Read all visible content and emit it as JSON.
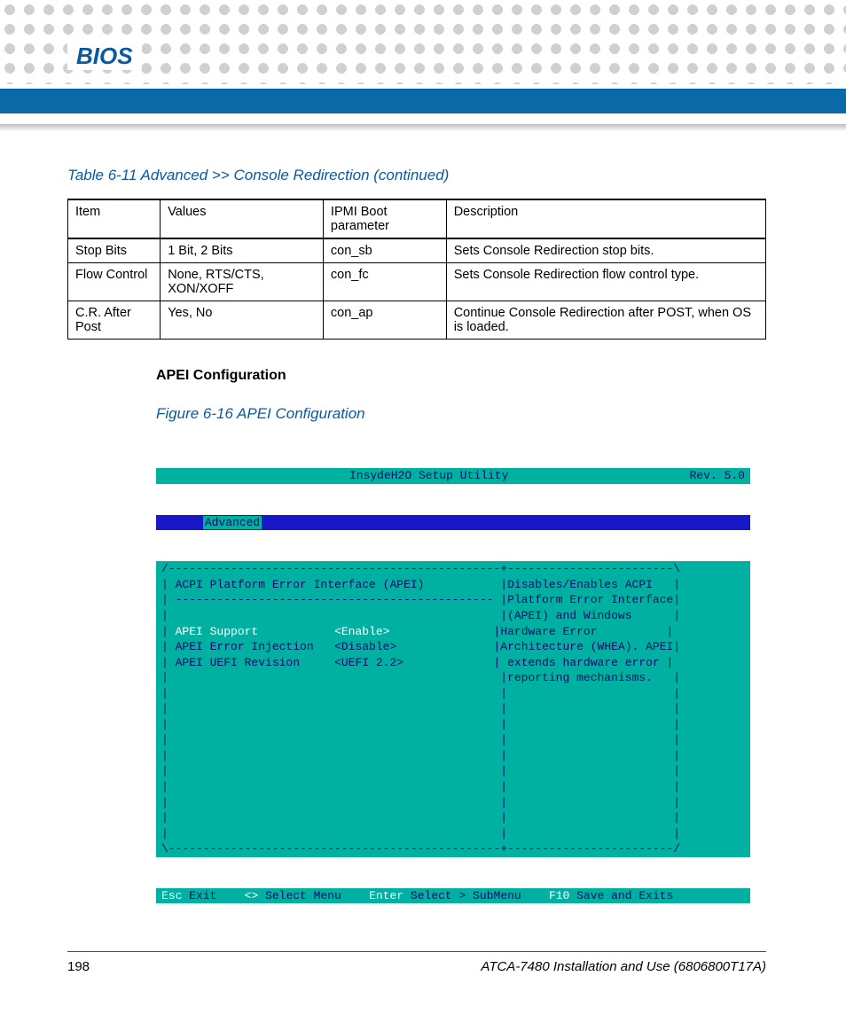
{
  "header": {
    "title": "BIOS"
  },
  "table": {
    "caption": "Table 6-11 Advanced >> Console Redirection (continued)",
    "headers": [
      "Item",
      "Values",
      "IPMI Boot parameter",
      "Description"
    ],
    "rows": [
      {
        "item": "Stop Bits",
        "values": "1 Bit, 2 Bits",
        "param": "con_sb",
        "desc": "Sets Console Redirection stop bits."
      },
      {
        "item": "Flow Control",
        "values": "None, RTS/CTS, XON/XOFF",
        "param": "con_fc",
        "desc": "Sets Console Redirection flow control type."
      },
      {
        "item": "C.R. After Post",
        "values": "Yes, No",
        "param": "con_ap",
        "desc": "Continue Console Redirection after POST, when OS is loaded."
      }
    ]
  },
  "section_heading": "APEI Configuration",
  "figure_caption": "Figure 6-16     APEI Configuration",
  "bios": {
    "title_center": "InsydeH2O Setup Utility",
    "title_right": "Rev. 5.0",
    "tab_active": "Advanced",
    "panel_title": "ACPI Platform Error Interface (APEI)",
    "items": [
      {
        "label": "APEI Support",
        "value": "<Enable>",
        "selected": true
      },
      {
        "label": "APEI Error Injection",
        "value": "<Disable>",
        "selected": false
      },
      {
        "label": "APEI UEFI Revision",
        "value": "<UEFI 2.2>",
        "selected": false
      }
    ],
    "help_lines": [
      "Disables/Enables ACPI",
      "Platform Error Interface",
      "(APEI) and Windows",
      "Hardware Error",
      "Architecture (WHEA). APEI",
      " extends hardware error",
      "reporting mechanisms."
    ],
    "footer": {
      "esc_key": "Esc",
      "esc_label": " Exit",
      "arrows_key": "<>",
      "arrows_label": " Select Menu",
      "enter_key": "Enter",
      "enter_label": " Select > SubMenu",
      "f10_key": "F10",
      "f10_label": " Save and Exits"
    }
  },
  "page_footer": {
    "page_number": "198",
    "doc_title": "ATCA-7480 Installation and Use (6806800T17A)"
  }
}
